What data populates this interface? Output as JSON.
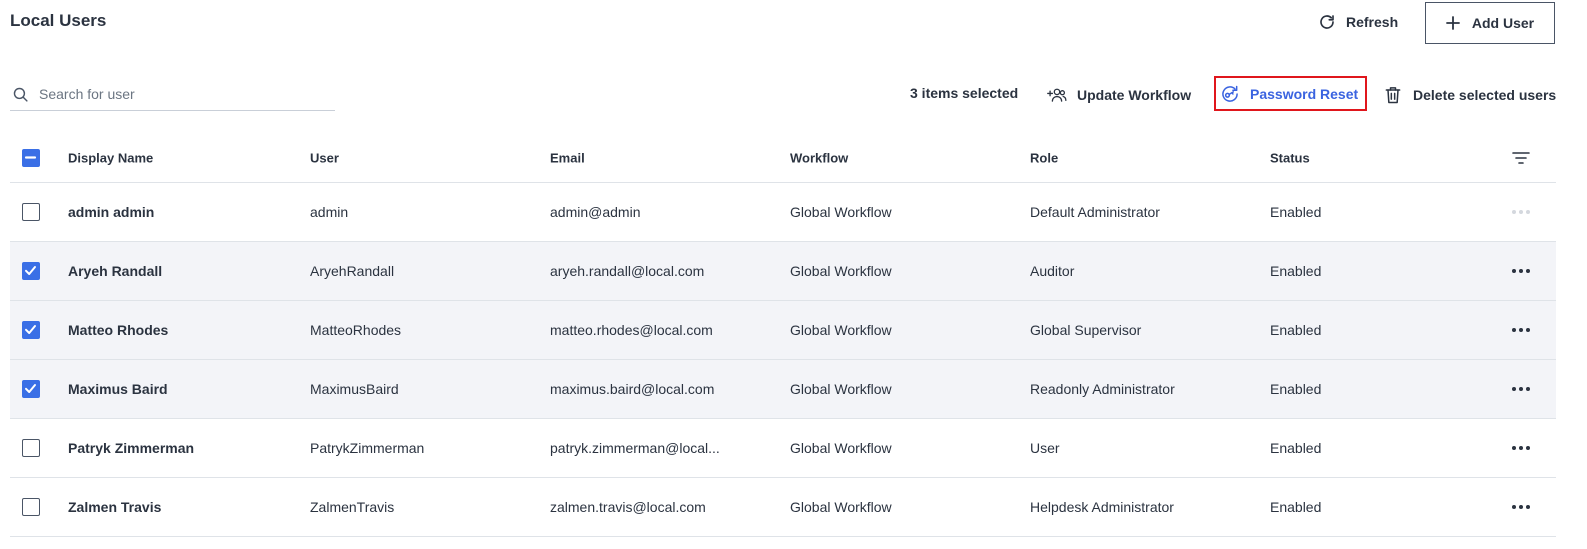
{
  "header": {
    "title": "Local Users",
    "refresh_label": "Refresh",
    "add_user_label": "Add User"
  },
  "search": {
    "placeholder": "Search for user",
    "value": ""
  },
  "toolbar": {
    "selected_count": "3 items selected",
    "update_workflow_label": "Update Workflow",
    "password_reset_label": "Password Reset",
    "delete_selected_label": "Delete selected users"
  },
  "table": {
    "columns": [
      "Display Name",
      "User",
      "Email",
      "Workflow",
      "Role",
      "Status"
    ],
    "rows": [
      {
        "display_name": "admin admin",
        "user": "admin",
        "email": "admin@admin",
        "workflow": "Global Workflow",
        "role": "Default Administrator",
        "status": "Enabled",
        "checked": false
      },
      {
        "display_name": "Aryeh Randall",
        "user": "AryehRandall",
        "email": "aryeh.randall@local.com",
        "workflow": "Global Workflow",
        "role": "Auditor",
        "status": "Enabled",
        "checked": true
      },
      {
        "display_name": "Matteo Rhodes",
        "user": "MatteoRhodes",
        "email": "matteo.rhodes@local.com",
        "workflow": "Global Workflow",
        "role": "Global Supervisor",
        "status": "Enabled",
        "checked": true
      },
      {
        "display_name": "Maximus Baird",
        "user": "MaximusBaird",
        "email": "maximus.baird@local.com",
        "workflow": "Global Workflow",
        "role": "Readonly Administrator",
        "status": "Enabled",
        "checked": true
      },
      {
        "display_name": "Patryk Zimmerman",
        "user": "PatrykZimmerman",
        "email": "patryk.zimmerman@local...",
        "workflow": "Global Workflow",
        "role": "User",
        "status": "Enabled",
        "checked": false
      },
      {
        "display_name": "Zalmen Travis",
        "user": "ZalmenTravis",
        "email": "zalmen.travis@local.com",
        "workflow": "Global Workflow",
        "role": "Helpdesk Administrator",
        "status": "Enabled",
        "checked": false
      }
    ]
  },
  "colors": {
    "accent": "#3a6fe6",
    "link": "#3a63e0",
    "highlight_border": "#e0161c",
    "selected_row_bg": "#f3f4f8",
    "text": "#2b3340"
  },
  "icons": {
    "refresh": "refresh-icon",
    "add": "plus-icon",
    "search": "search-icon",
    "update_workflow": "users-plus-icon",
    "password_reset": "key-reset-icon",
    "delete": "trash-icon",
    "filter": "filter-icon",
    "more": "more-horizontal-icon"
  }
}
